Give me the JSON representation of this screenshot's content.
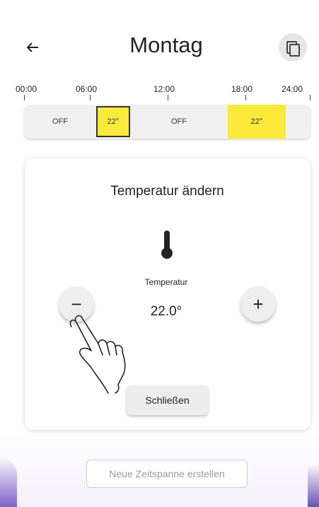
{
  "header": {
    "back_icon": "arrow-left-icon",
    "title": "Montag",
    "copy_icon": "copy-icon"
  },
  "timeline": {
    "time_labels": [
      "00:00",
      "06:00",
      "12:00",
      "18:00",
      "24:00"
    ],
    "segments": [
      {
        "label": "OFF",
        "state": "off"
      },
      {
        "label": "22°",
        "state": "heat",
        "selected": true
      },
      {
        "label": "OFF",
        "state": "off"
      },
      {
        "label": "22°",
        "state": "heat"
      },
      {
        "label": "",
        "state": "off"
      }
    ],
    "colors": {
      "heat": "#fbea3a",
      "off": "#f0f0f0"
    }
  },
  "dialog": {
    "title": "Temperatur ändern",
    "thermometer_icon": "thermometer-icon",
    "temperature_label": "Temperatur",
    "temperature_value": "22.0°",
    "minus_label": "−",
    "plus_label": "+",
    "close_label": "Schließen"
  },
  "footer": {
    "new_timespan_label": "Neue Zeitspanne erstellen"
  }
}
